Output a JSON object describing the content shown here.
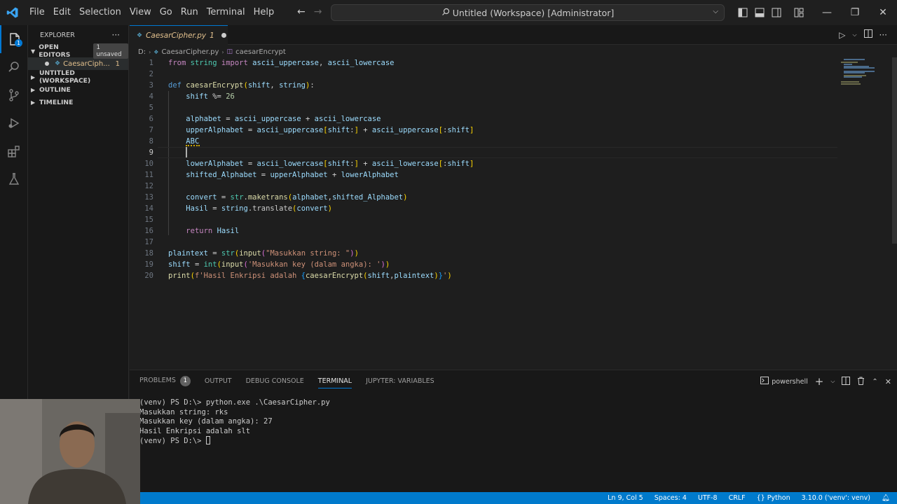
{
  "titlebar": {
    "menu": [
      "File",
      "Edit",
      "Selection",
      "View",
      "Go",
      "Run",
      "Terminal",
      "Help"
    ],
    "command_center": "Untitled (Workspace) [Administrator]"
  },
  "sidebar": {
    "header": "EXPLORER",
    "open_editors": "OPEN EDITORS",
    "unsaved": "1 unsaved",
    "open_file": "CaesarCiph...",
    "open_file_problems": "1",
    "sections": [
      "UNTITLED (WORKSPACE)",
      "OUTLINE",
      "TIMELINE"
    ]
  },
  "tab": {
    "label": "CaesarCipher.py",
    "problems": "1"
  },
  "breadcrumb": {
    "drive": "D:",
    "file": "CaesarCipher.py",
    "symbol": "caesarEncrypt"
  },
  "editor": {
    "line_numbers": [
      "1",
      "2",
      "3",
      "4",
      "5",
      "6",
      "7",
      "8",
      "9",
      "10",
      "11",
      "12",
      "13",
      "14",
      "15",
      "16",
      "17",
      "18",
      "19",
      "20"
    ],
    "active_line": "9"
  },
  "panel": {
    "tabs": [
      "PROBLEMS",
      "OUTPUT",
      "DEBUG CONSOLE",
      "TERMINAL",
      "JUPYTER: VARIABLES"
    ],
    "problems_count": "1",
    "active_tab": "TERMINAL",
    "shell": "powershell",
    "terminal_lines": [
      "(venv) PS D:\\> python.exe .\\CaesarCipher.py",
      "Masukkan string: rks",
      "Masukkan key (dalam angka): 27",
      "Hasil Enkripsi adalah slt",
      "(venv) PS D:\\> "
    ]
  },
  "statusbar": {
    "position": "Ln 9, Col 5",
    "spaces": "Spaces: 4",
    "encoding": "UTF-8",
    "eol": "CRLF",
    "language": "Python",
    "interpreter": "3.10.0 ('venv': venv)"
  },
  "colors": {
    "accent": "#0078d4",
    "statusbar": "#007acc",
    "modified_file": "#e2c08d"
  }
}
